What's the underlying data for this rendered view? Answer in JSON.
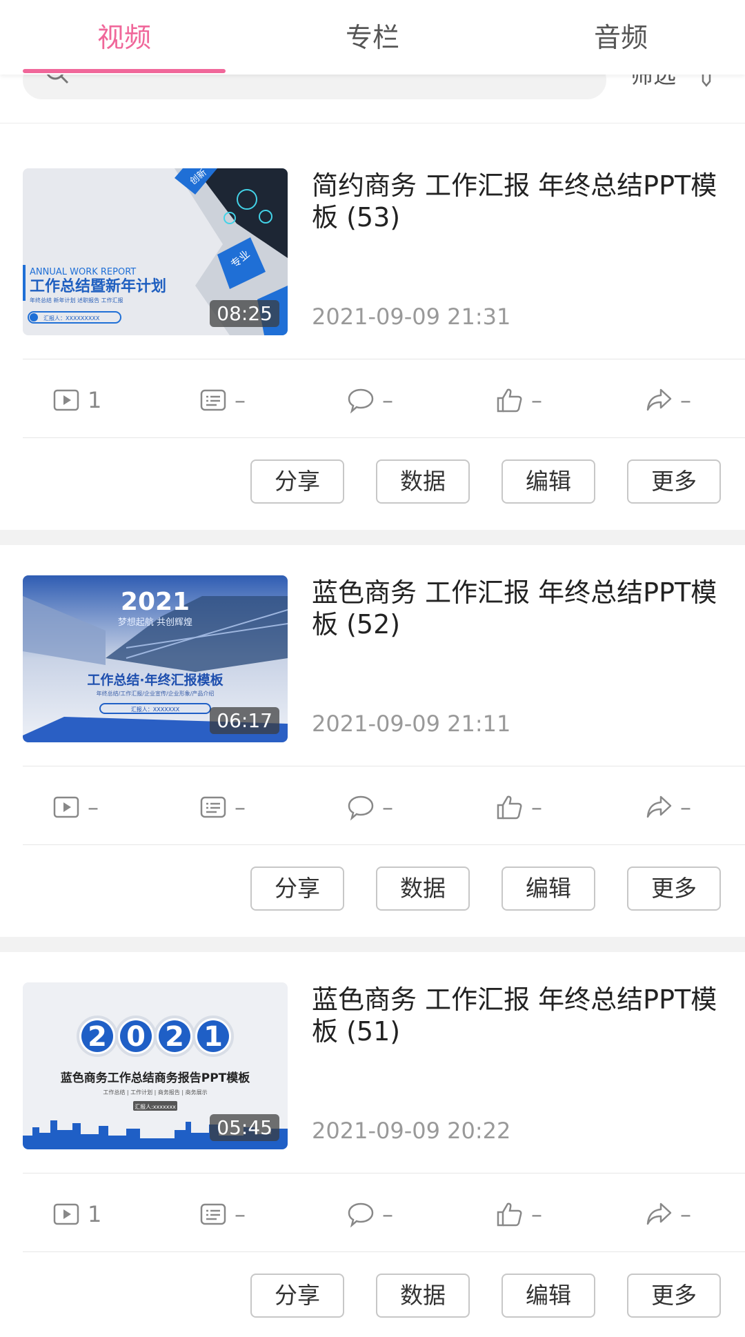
{
  "tabs": [
    {
      "label": "视频",
      "active": true
    },
    {
      "label": "专栏",
      "active": false
    },
    {
      "label": "音频",
      "active": false
    }
  ],
  "filter": {
    "label": "筛选"
  },
  "colors": {
    "accent": "#f0679a",
    "thumb_blue": "#1e5fc6"
  },
  "buttons": {
    "share": "分享",
    "data": "数据",
    "edit": "编辑",
    "more": "更多"
  },
  "videos": [
    {
      "title": "简约商务 工作汇报 年终总结PPT模板 (53)",
      "date": "2021-09-09 21:31",
      "duration": "08:25",
      "thumb": {
        "en": "ANNUAL WORK REPORT",
        "cn": "工作总结暨新年计划",
        "sub": "年终总结 新年计划 述职报告 工作汇报",
        "tag1": "创新",
        "tag2": "专业",
        "reporter": "汇报人：XXXXXXXXX"
      },
      "stats": {
        "plays": "1",
        "danmaku": "–",
        "comments": "–",
        "likes": "–",
        "shares": "–"
      }
    },
    {
      "title": "蓝色商务 工作汇报 年终总结PPT模板 (52)",
      "date": "2021-09-09 21:11",
      "duration": "06:17",
      "thumb": {
        "year": "2021",
        "slogan": "梦想起航 共创辉煌",
        "cn": "工作总结·年终汇报模板",
        "sub": "年终总结/工作汇报/企业宣传/企业形象/产品介绍",
        "reporter": "汇报人：XXXXXXX"
      },
      "stats": {
        "plays": "–",
        "danmaku": "–",
        "comments": "–",
        "likes": "–",
        "shares": "–"
      }
    },
    {
      "title": "蓝色商务 工作汇报 年终总结PPT模板 (51)",
      "date": "2021-09-09 20:22",
      "duration": "05:45",
      "thumb": {
        "digits": [
          "2",
          "0",
          "2",
          "1"
        ],
        "cn": "蓝色商务工作总结商务报告PPT模板",
        "sub": "工作总结 | 工作计划 | 商务报告 | 商务展示",
        "reporter": "汇报人:xxxxxxx"
      },
      "stats": {
        "plays": "1",
        "danmaku": "–",
        "comments": "–",
        "likes": "–",
        "shares": "–"
      }
    }
  ]
}
